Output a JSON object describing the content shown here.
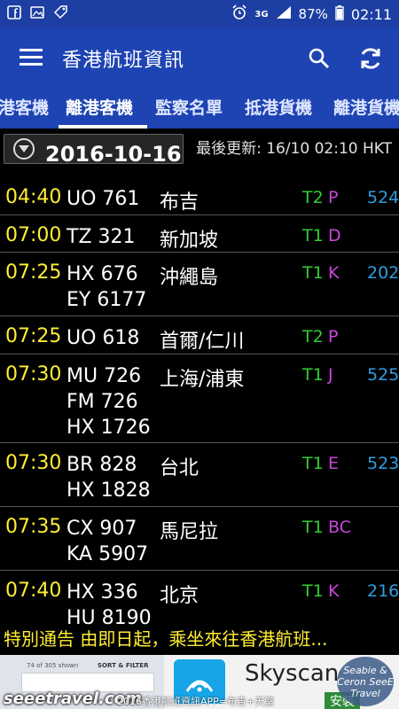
{
  "status_bar": {
    "battery": "87%",
    "network": "3G",
    "time": "02:11"
  },
  "app_bar": {
    "title": "香港航班資訊"
  },
  "tabs": [
    {
      "label": "港客機",
      "active": false
    },
    {
      "label": "離港客機",
      "active": true
    },
    {
      "label": "監察名單",
      "active": false
    },
    {
      "label": "抵港貨機",
      "active": false
    },
    {
      "label": "離港貨機",
      "active": false
    }
  ],
  "date_bar": {
    "date": "2016-10-16",
    "last_updated": "最後更新: 16/10 02:10 HKT"
  },
  "flights": [
    {
      "time": "04:40",
      "numbers": [
        "UO 761"
      ],
      "destination": "布吉",
      "terminal": "T2",
      "aisle": "P",
      "gate": "524"
    },
    {
      "time": "07:00",
      "numbers": [
        "TZ 321"
      ],
      "destination": "新加坡",
      "terminal": "T1",
      "aisle": "D",
      "gate": ""
    },
    {
      "time": "07:25",
      "numbers": [
        "HX 676",
        "EY 6177"
      ],
      "destination": "沖繩島",
      "terminal": "T1",
      "aisle": "K",
      "gate": "202"
    },
    {
      "time": "07:25",
      "numbers": [
        "UO 618"
      ],
      "destination": "首爾/仁川",
      "terminal": "T2",
      "aisle": "P",
      "gate": ""
    },
    {
      "time": "07:30",
      "numbers": [
        "MU 726",
        "FM 726",
        "HX 1726"
      ],
      "destination": "上海/浦東",
      "terminal": "T1",
      "aisle": "J",
      "gate": "525"
    },
    {
      "time": "07:30",
      "numbers": [
        "BR 828",
        "HX 1828"
      ],
      "destination": "台北",
      "terminal": "T1",
      "aisle": "E",
      "gate": "523"
    },
    {
      "time": "07:35",
      "numbers": [
        "CX 907",
        "KA 5907"
      ],
      "destination": "馬尼拉",
      "terminal": "T1",
      "aisle": "BC",
      "gate": ""
    },
    {
      "time": "07:40",
      "numbers": [
        "HX 336",
        "HU 8190"
      ],
      "destination": "北京",
      "terminal": "T1",
      "aisle": "K",
      "gate": "216"
    }
  ],
  "notice": "特別通告 由即日起，乘坐來往香港航班...",
  "ad": {
    "mini_text": "74 of 305 shown",
    "mini_button": "SORT & FILTER",
    "brand": "Skyscan",
    "install": "安裝",
    "site_credit": "seeetravel.com",
    "site_credit_small": "2016香港航班資訊APP=布吉+天堂",
    "watermark": "Seabie & Ceron SeeE Travel"
  },
  "colors": {
    "status_bar": "#1d3fa3",
    "app_bar": "#1e44b3",
    "time": "#ffee33",
    "terminal": "#33cc33",
    "aisle": "#cc44dd",
    "gate": "#2f9de0"
  }
}
